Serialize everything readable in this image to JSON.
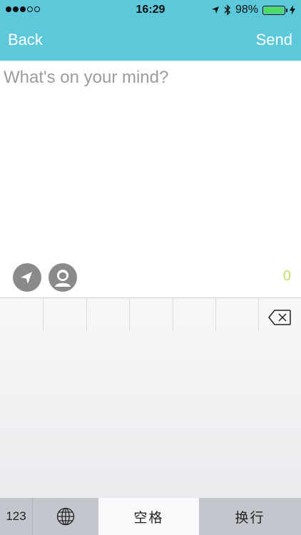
{
  "status_bar": {
    "time": "16:29",
    "battery_text": "98%",
    "battery_level": 0.98,
    "signal_dots_filled": 3,
    "signal_dots_total": 5,
    "icons": [
      "location-arrow-icon",
      "bluetooth-icon",
      "charging-bolt-icon"
    ]
  },
  "nav": {
    "back_label": "Back",
    "send_label": "Send"
  },
  "compose": {
    "placeholder": "What's on your mind?",
    "value": ""
  },
  "toolbar": {
    "location_icon": "location-arrow-icon",
    "contact_icon": "person-icon",
    "char_count": "0"
  },
  "keyboard": {
    "num_key": "123",
    "globe_icon": "globe-icon",
    "space_label": "空格",
    "return_label": "换行",
    "backspace_icon": "backspace-icon"
  },
  "colors": {
    "accent": "#5cc8d9",
    "count": "#bde06a",
    "icon_gray": "#8a8a8a"
  }
}
